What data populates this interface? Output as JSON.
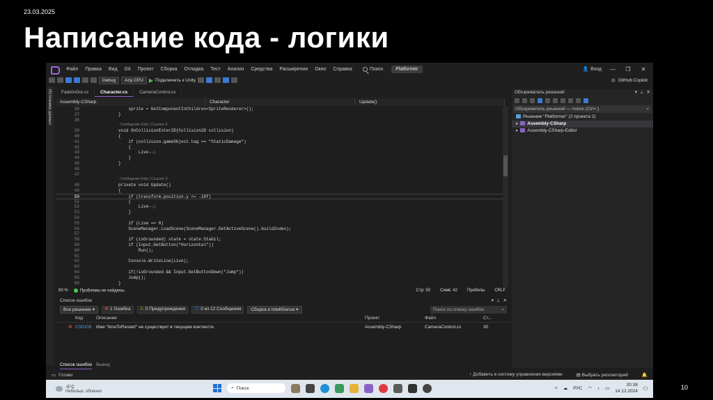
{
  "slide": {
    "date": "23.03.2025",
    "title": "Написание кода - логики",
    "page": "10"
  },
  "menu": [
    "Файл",
    "Правка",
    "Вид",
    "Git",
    "Проект",
    "Сборка",
    "Отладка",
    "Тест",
    "Анализ",
    "Средства",
    "Расширения",
    "Окно",
    "Справка"
  ],
  "search_label": "Поиск",
  "solution_name": "Platformer",
  "login_label": "Вход",
  "toolbar": {
    "config": "Debug",
    "platform": "Any CPU",
    "run_label": "Подключить к Unity",
    "copilot": "GitHub Copilot"
  },
  "left_strip_label": "Источники данных",
  "tabs": [
    "FadeInOut.cs",
    "Character.cs",
    "CameraControl.cs"
  ],
  "navbar": {
    "project": "Assembly-CSharp",
    "class": "Character",
    "member": "Update()"
  },
  "code_lines": [
    {
      "n": "36",
      "t": "    sprite = GetComponentInChildren<SpriteRenderer>();"
    },
    {
      "n": "37",
      "t": "}"
    },
    {
      "n": "38",
      "t": ""
    },
    {
      "n": "",
      "t": "◦ Сообщение Unity | Ссылок: 0",
      "lens": true
    },
    {
      "n": "39",
      "t": "void OnCollisionEnter2D(Collision2D collision)"
    },
    {
      "n": "40",
      "t": "{"
    },
    {
      "n": "41",
      "t": "    if (collision.gameObject.tag == \"StaticDamage\")"
    },
    {
      "n": "42",
      "t": "    {"
    },
    {
      "n": "43",
      "t": "        Live--;"
    },
    {
      "n": "44",
      "t": "    }"
    },
    {
      "n": "45",
      "t": "}"
    },
    {
      "n": "46",
      "t": ""
    },
    {
      "n": "47",
      "t": ""
    },
    {
      "n": "",
      "t": "◦ Сообщение Unity | Ссылок: 0",
      "lens": true
    },
    {
      "n": "48",
      "t": "private void Update()"
    },
    {
      "n": "49",
      "t": "{"
    },
    {
      "n": "50",
      "t": "    if (transform.position.y <= -10f)",
      "current": true
    },
    {
      "n": "51",
      "t": "    {"
    },
    {
      "n": "52",
      "t": "        Live--;"
    },
    {
      "n": "53",
      "t": "    }"
    },
    {
      "n": "54",
      "t": ""
    },
    {
      "n": "55",
      "t": "    if (Live == 0)"
    },
    {
      "n": "56",
      "t": "    SceneManager.LoadScene(SceneManager.GetActiveScene().buildIndex);"
    },
    {
      "n": "57",
      "t": ""
    },
    {
      "n": "58",
      "t": "    if (isGrounded) state = state.Stabil;"
    },
    {
      "n": "59",
      "t": "    if (Input.GetButton(\"Horizontal\"))"
    },
    {
      "n": "60",
      "t": "        Run();"
    },
    {
      "n": "61",
      "t": ""
    },
    {
      "n": "62",
      "t": "    Console.WriteLine(Live);"
    },
    {
      "n": "63",
      "t": ""
    },
    {
      "n": "64",
      "t": "    if(!isGrounded && Input.GetButtonDown(\"Jump\"))"
    },
    {
      "n": "65",
      "t": "    Jump();"
    },
    {
      "n": "66",
      "t": "}"
    }
  ],
  "editor_status": {
    "zoom": "83 %",
    "issues": "Проблемы не найдены.",
    "line": "Стр: 50",
    "col": "Симв: 42",
    "spaces": "Пробелы",
    "eol": "CRLF"
  },
  "solution_explorer": {
    "title": "Обозреватель решений",
    "search_placeholder": "Обозреватель решений — поиск (Ctrl+;)",
    "root": "Решение \"Platformer\" (2 проекта 2)",
    "items": [
      "Assembly-CSharp",
      "Assembly-CSharp-Editor"
    ]
  },
  "error_list": {
    "title": "Список ошибок",
    "scope": "Все решение",
    "errors_btn": "1 Ошибка",
    "warnings_btn": "0 Предупреждения",
    "messages_btn": "0 из 12 Сообщения",
    "build_filter": "Сборка и IntelliSense",
    "search_placeholder": "Поиск по списку ошибок",
    "columns": {
      "code": "Код",
      "desc": "Описание",
      "project": "Проект",
      "file": "Файл",
      "line": "Ст..."
    },
    "rows": [
      {
        "code": "CS0103",
        "desc": "Имя \"timeToRestart\" не существует в текущем контексте.",
        "project": "Assembly-CSharp",
        "file": "CameraControl.cs",
        "line": "30"
      }
    ],
    "bottom_tabs": [
      "Список ошибок",
      "Вывод"
    ]
  },
  "statusbar": {
    "ready": "Готово",
    "source_control": "Добавить в систему управления версиями",
    "repo": "Выбрать репозиторий"
  },
  "taskbar": {
    "temp": "-5°C",
    "weather": "Небольш. облачно",
    "search": "Поиск",
    "lang": "РУС",
    "time": "20:38",
    "date": "14.12.2024"
  }
}
